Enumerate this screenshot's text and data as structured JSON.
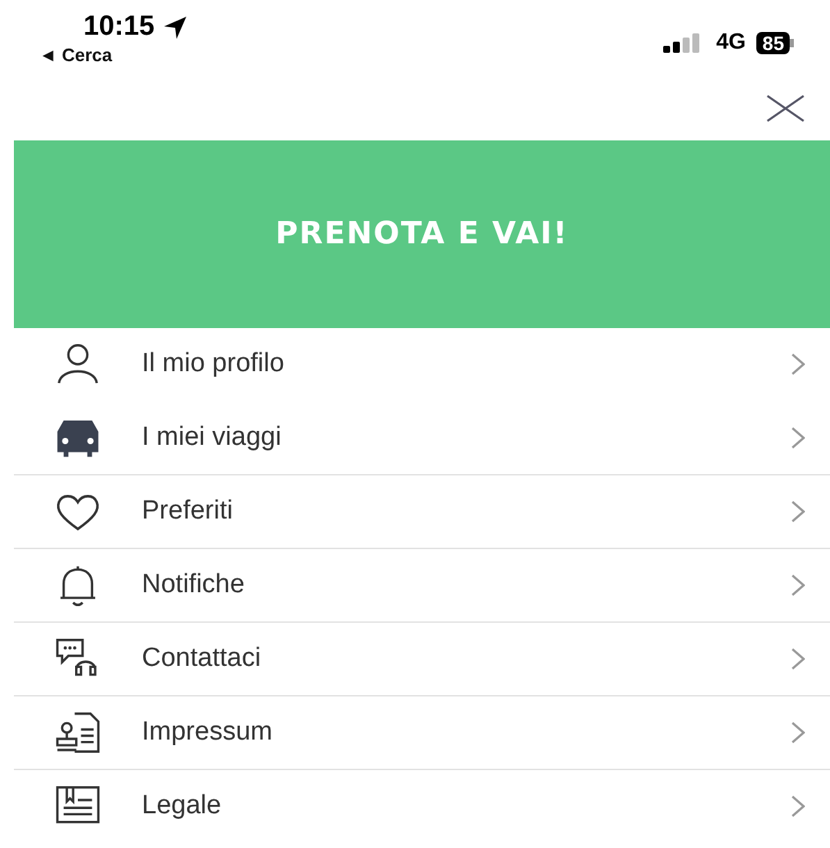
{
  "status_bar": {
    "time": "10:15",
    "back_label": "◄ Cerca",
    "network": "4G",
    "battery": "85"
  },
  "banner": {
    "title": "PRENOTA E VAI!"
  },
  "menu": [
    {
      "label": "Il mio profilo",
      "divider_below": false
    },
    {
      "label": "I miei viaggi",
      "divider_below": true
    },
    {
      "label": "Preferiti",
      "divider_below": true
    },
    {
      "label": "Notifiche",
      "divider_below": true
    },
    {
      "label": "Contattaci",
      "divider_below": true
    },
    {
      "label": "Impressum",
      "divider_below": true
    },
    {
      "label": "Legale",
      "divider_below": false
    }
  ]
}
